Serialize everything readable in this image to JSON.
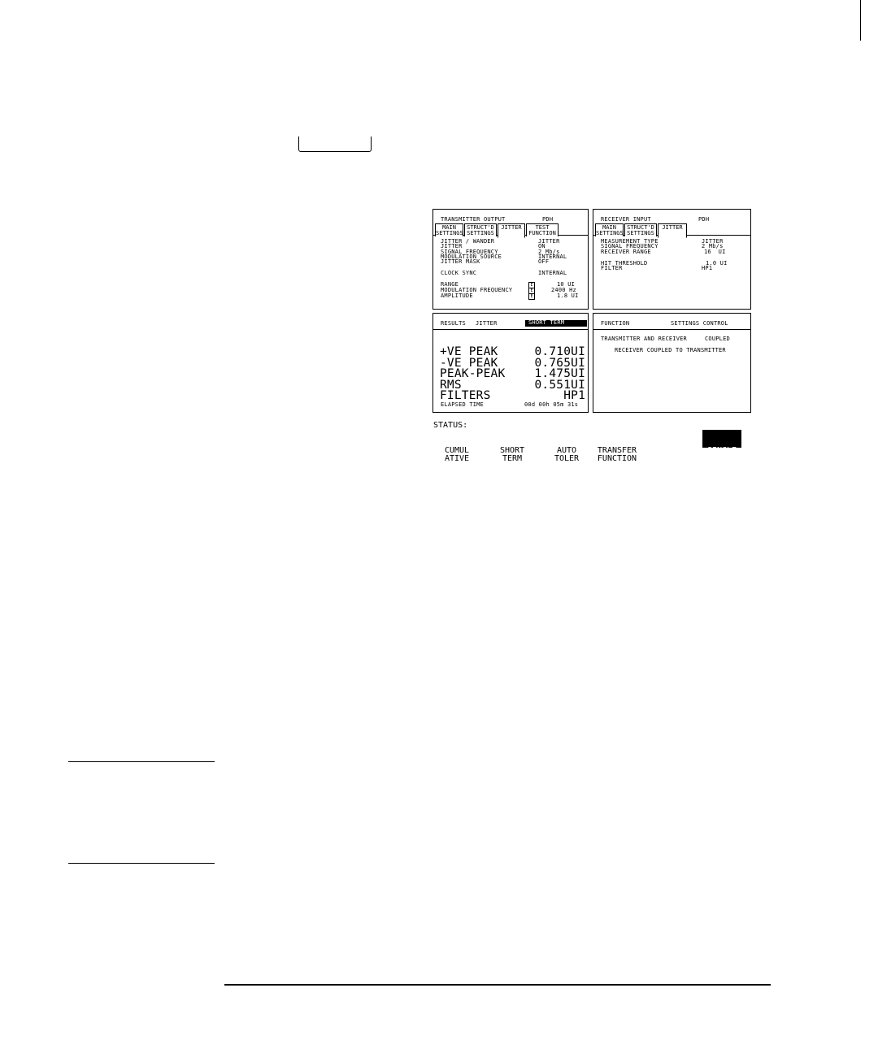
{
  "tx_panel": {
    "title": "TRANSMITTER OUTPUT",
    "mode": "PDH",
    "tabs": [
      {
        "l1": "MAIN",
        "l2": "SETTINGS"
      },
      {
        "l1": "STRUCT'D",
        "l2": "SETTINGS"
      },
      {
        "l1": "JITTER",
        "l2": ""
      },
      {
        "l1": "TEST",
        "l2": "FUNCTION"
      }
    ],
    "rows": [
      {
        "label": "JITTER / WANDER",
        "value": "JITTER"
      },
      {
        "label": "JITTER",
        "value": "ON"
      },
      {
        "label": "SIGNAL FREQUENCY",
        "value": "2 Mb/s"
      },
      {
        "label": "MODULATION SOURCE",
        "value": "INTERNAL"
      },
      {
        "label": "JITTER MASK",
        "value": "OFF"
      },
      {
        "label": "CLOCK SYNC",
        "value": "INTERNAL"
      }
    ],
    "adj_rows": [
      {
        "label": "RANGE",
        "mark": "E",
        "value": "10 UI"
      },
      {
        "label": "MODULATION FREQUENCY",
        "mark": "E",
        "value": "2400 Hz"
      },
      {
        "label": "AMPLITUDE",
        "mark": "E",
        "value": "1.8 UI"
      }
    ]
  },
  "rx_panel": {
    "title": "RECEIVER INPUT",
    "mode": "PDH",
    "tabs": [
      {
        "l1": "MAIN",
        "l2": "SETTINGS"
      },
      {
        "l1": "STRUCT'D",
        "l2": "SETTINGS"
      },
      {
        "l1": "JITTER",
        "l2": ""
      }
    ],
    "rows": [
      {
        "label": "MEASUREMENT TYPE",
        "value": "JITTER"
      },
      {
        "label": "SIGNAL FREQUENCY",
        "value": "2 Mb/s"
      },
      {
        "label": "RECEIVER RANGE",
        "value": "16  UI"
      },
      {
        "label": "HIT THRESHOLD",
        "value": "1.0 UI"
      },
      {
        "label": "FILTER",
        "value": "HP1"
      }
    ]
  },
  "results_panel": {
    "title": "RESULTS",
    "category": "JITTER",
    "badge": "SHORT TERM",
    "rows": [
      {
        "label": "+VE PEAK",
        "value": "0.710UI"
      },
      {
        "label": "-VE PEAK",
        "value": "0.765UI"
      },
      {
        "label": "PEAK-PEAK",
        "value": "1.475UI"
      },
      {
        "label": "RMS",
        "value": "0.551UI"
      },
      {
        "label": "FILTERS",
        "value": "HP1"
      }
    ],
    "elapsed_label": "ELAPSED TIME",
    "elapsed_value": "00d 00h 05m 31s"
  },
  "function_panel": {
    "title": "FUNCTION",
    "mode": "SETTINGS CONTROL",
    "line1_label": "TRANSMITTER AND RECEIVER",
    "line1_value": "COUPLED",
    "line2": "RECEIVER COUPLED TO TRANSMITTER"
  },
  "status": {
    "label": "STATUS:",
    "softkeys": [
      {
        "l1": "CUMUL",
        "l2": "ATIVE"
      },
      {
        "l1": "SHORT",
        "l2": "TERM"
      },
      {
        "l1": "AUTO",
        "l2": "TOLER"
      },
      {
        "l1": "TRANSFER",
        "l2": "FUNCTION"
      },
      {
        "l1": "SINGLE",
        "l2": "WINDOW"
      }
    ]
  }
}
